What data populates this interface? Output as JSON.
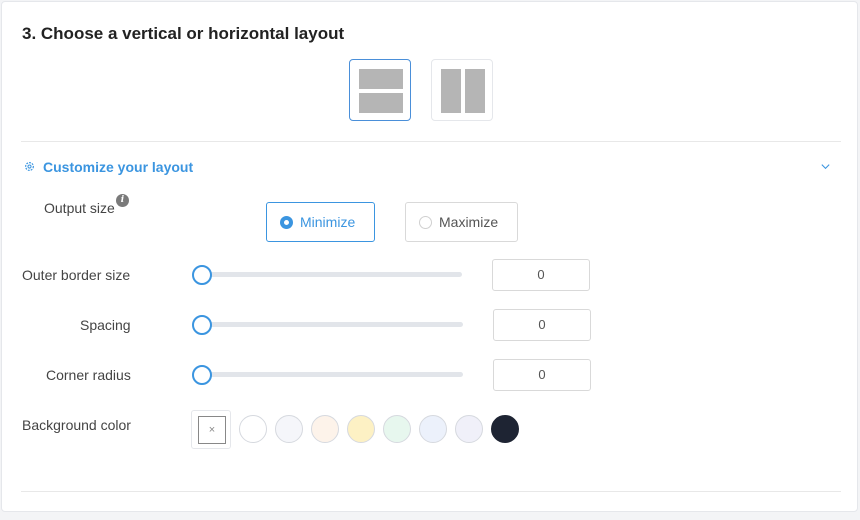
{
  "section": {
    "title": "3. Choose a vertical or horizontal layout",
    "layouts": [
      {
        "name": "vertical",
        "selected": true
      },
      {
        "name": "horizontal",
        "selected": false
      }
    ]
  },
  "customize": {
    "title": "Customize your layout",
    "icon": "gear-icon",
    "expand_icon": "chevron-down-icon",
    "accent_color": "#3b95e0"
  },
  "output_size": {
    "label": "Output size",
    "info_glyph": "i",
    "options": [
      {
        "label": "Minimize",
        "selected": true
      },
      {
        "label": "Maximize",
        "selected": false
      }
    ]
  },
  "outer_border": {
    "label": "Outer border size",
    "value": "0"
  },
  "spacing": {
    "label": "Spacing",
    "value": "0"
  },
  "corner_radius": {
    "label": "Corner radius",
    "value": "0"
  },
  "background": {
    "label": "Background color",
    "none_glyph": "×",
    "colors": [
      "#ffffff",
      "#f5f6fa",
      "#fdf3ea",
      "#fdf1c4",
      "#e7f7ee",
      "#ecf1fb",
      "#f0f0f9",
      "#1e2433"
    ]
  }
}
